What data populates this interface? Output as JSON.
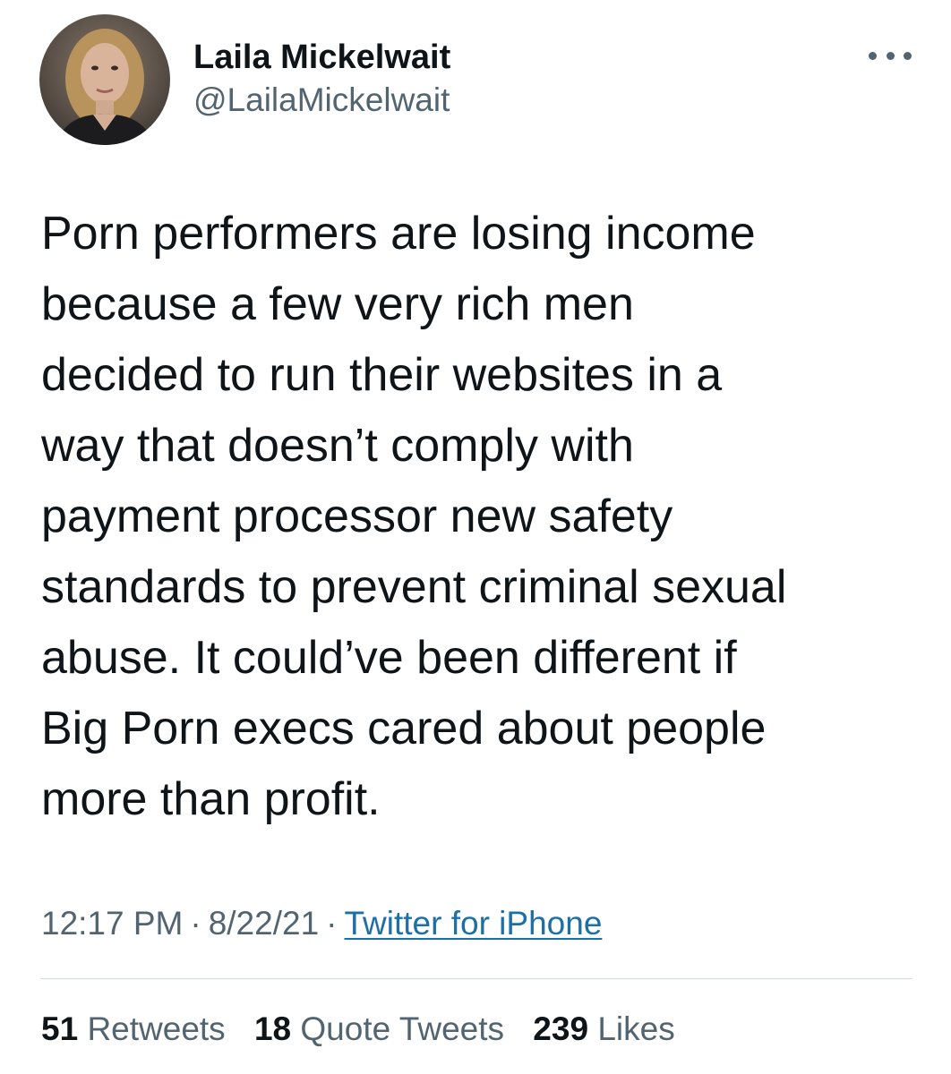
{
  "author": {
    "display_name": "Laila Mickelwait",
    "handle": "@LailaMickelwait",
    "avatar_icon": "profile-photo"
  },
  "more_icon": "more-options-icon",
  "tweet": {
    "lines": [
      "Porn performers are losing income",
      "because a few very rich men",
      "decided to run their websites in a",
      "way that doesn’t comply with",
      "payment processor new safety",
      "standards to prevent criminal sexual",
      "abuse. It could’ve been different if",
      "Big Porn execs cared about people",
      "more than profit."
    ]
  },
  "meta": {
    "time": "12:17 PM",
    "date": "8/22/21",
    "source": "Twitter for iPhone",
    "separator": "·"
  },
  "stats": {
    "retweets_count": "51",
    "retweets_label": "Retweets",
    "quotes_count": "18",
    "quotes_label": "Quote Tweets",
    "likes_count": "239",
    "likes_label": "Likes"
  },
  "colors": {
    "text_primary": "#0f1419",
    "text_secondary": "#536471",
    "link": "#1d6fa5",
    "divider": "#cfd9de"
  }
}
